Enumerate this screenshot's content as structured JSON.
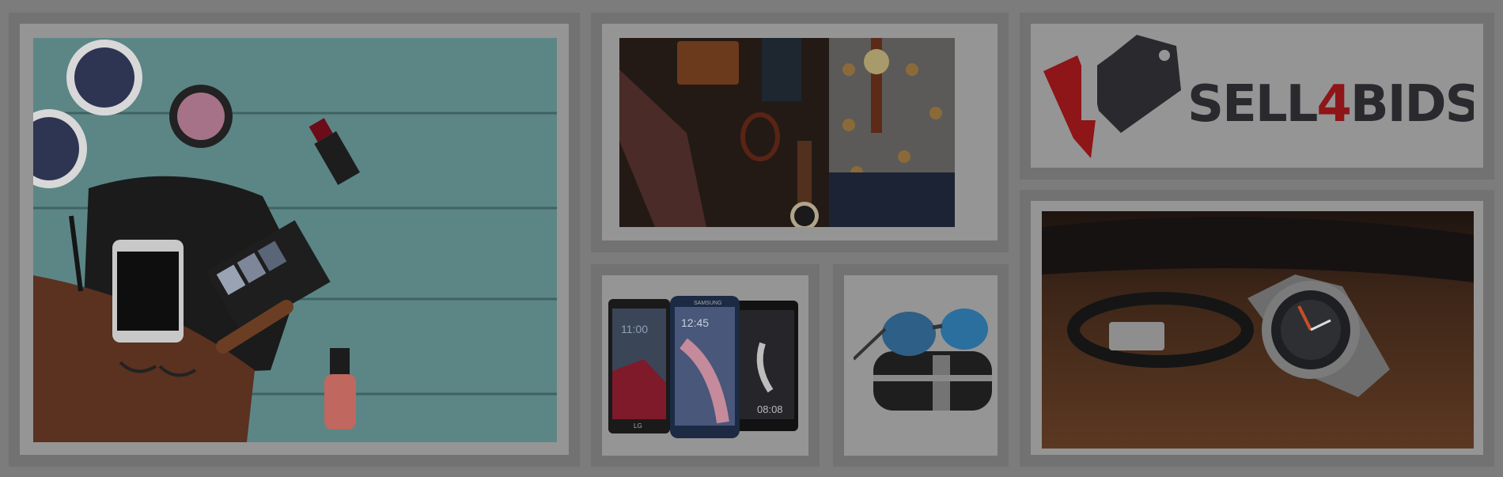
{
  "brand": {
    "name_part1": "SELL",
    "name_digit": "4",
    "name_part2": "BIDS",
    "colors": {
      "dark": "#2a2a2e",
      "accent": "#8e1518"
    }
  },
  "tiles": [
    {
      "key": "accessories",
      "subject": "accessories-flatlay"
    },
    {
      "key": "mens-accessories",
      "subject": "mens-accessories-flatlay"
    },
    {
      "key": "phones",
      "subject": "smartphones"
    },
    {
      "key": "sunglasses",
      "subject": "sunglasses"
    },
    {
      "key": "watch",
      "subject": "watch-and-bracelet"
    }
  ],
  "phones": {
    "phone1_time": "11:00",
    "phone1_brand": "LG",
    "phone2_time": "12:45",
    "phone2_brand": "SAMSUNG",
    "phone3_time": "08:08"
  }
}
